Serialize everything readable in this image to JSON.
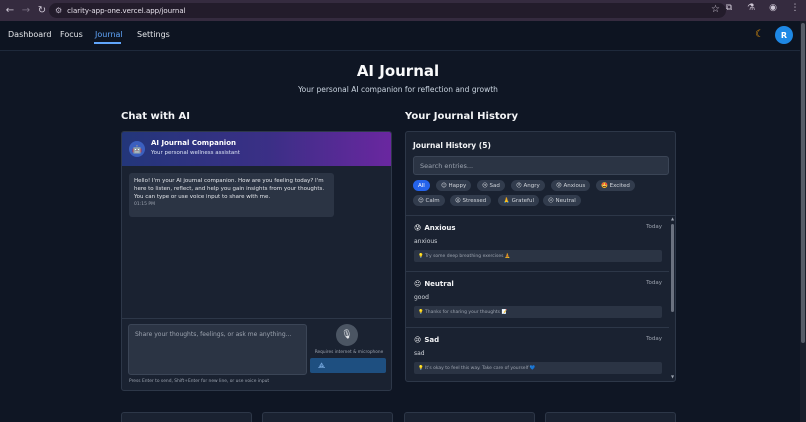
{
  "browser": {
    "url": "clarity-app-one.vercel.app/journal"
  },
  "nav": {
    "items": [
      {
        "label": "Dashboard"
      },
      {
        "label": "Focus"
      },
      {
        "label": "Journal"
      },
      {
        "label": "Settings"
      }
    ],
    "active": "Journal",
    "avatar_initial": "R"
  },
  "header": {
    "title": "AI Journal",
    "subtitle": "Your personal AI companion for reflection and growth"
  },
  "chat": {
    "section_title": "Chat with AI",
    "bot_name": "AI Journal Companion",
    "bot_subtitle": "Your personal wellness assistant",
    "message": "Hello! I'm your AI journal companion. How are you feeling today? I'm here to listen, reflect, and help you gain insights from your thoughts. You can type or use voice input to share with me.",
    "message_time": "01:15 PM",
    "input_placeholder": "Share your thoughts, feelings, or ask me anything...",
    "mic_note": "Requires internet & microphone",
    "hint": "Press Enter to send, Shift+Enter for new line, or use voice input"
  },
  "journal": {
    "section_title": "Your Journal History",
    "panel_title": "Journal History (5)",
    "search_placeholder": "Search entries...",
    "filters": [
      {
        "label": "All",
        "active": true
      },
      {
        "label": "😊 Happy"
      },
      {
        "label": "😢 Sad"
      },
      {
        "label": "😠 Angry"
      },
      {
        "label": "😰 Anxious"
      },
      {
        "label": "🤩 Excited"
      },
      {
        "label": "😌 Calm"
      },
      {
        "label": "😫 Stressed"
      },
      {
        "label": "🙏 Grateful"
      },
      {
        "label": "😐 Neutral"
      }
    ],
    "entries": [
      {
        "emoji": "😰",
        "mood": "Anxious",
        "date": "Today",
        "text": "anxious",
        "tip": "💡 Try some deep breathing exercises 🧘"
      },
      {
        "emoji": "😐",
        "mood": "Neutral",
        "date": "Today",
        "text": "good",
        "tip": "💡 Thanks for sharing your thoughts 📝"
      },
      {
        "emoji": "😢",
        "mood": "Sad",
        "date": "Today",
        "text": "sad",
        "tip": "💡 It's okay to feel this way. Take care of yourself 💙"
      }
    ]
  },
  "colors": {
    "background": "#0f1624",
    "panel": "#1a2231",
    "accent": "#60a5fa",
    "chip_active": "#2563eb"
  }
}
